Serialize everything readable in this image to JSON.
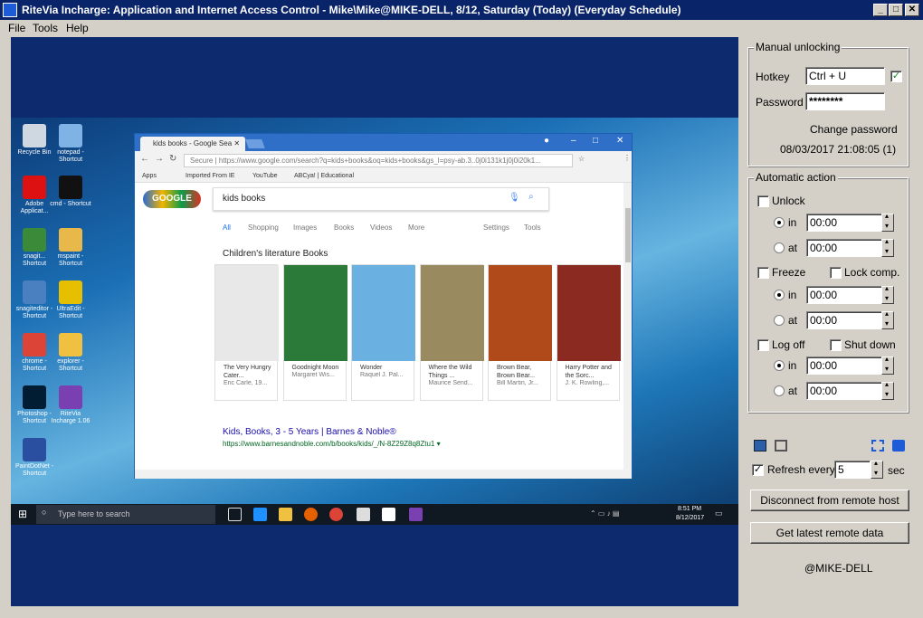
{
  "window": {
    "title": "RiteVia Incharge: Application and Internet Access Control - Mike\\Mike@MIKE-DELL, 8/12, Saturday (Today) (Everyday Schedule)",
    "minimize": "_",
    "maximize": "□",
    "close": "✕"
  },
  "menu": [
    "File",
    "Tools",
    "Help"
  ],
  "remote_desktop": {
    "desktop_icons": [
      {
        "label": "Recycle Bin",
        "color": "#cfd8e0"
      },
      {
        "label": "notepad - Shortcut",
        "color": "#7fb3e6"
      },
      {
        "label": "Adobe Applicat...",
        "color": "#d11"
      },
      {
        "label": "cmd - Shortcut",
        "color": "#111"
      },
      {
        "label": "snagit... Shortcut",
        "color": "#3a8a3a"
      },
      {
        "label": "mspaint - Shortcut",
        "color": "#e8b84a"
      },
      {
        "label": "snagiteditor - Shortcut",
        "color": "#4a7fc0"
      },
      {
        "label": "UltraEdit - Shortcut",
        "color": "#e6c000"
      },
      {
        "label": "chrome - Shortcut",
        "color": "#db4437"
      },
      {
        "label": "explorer - Shortcut",
        "color": "#f0c040"
      },
      {
        "label": "Photoshop - Shortcut",
        "color": "#001d34"
      },
      {
        "label": "RiteVia Incharge 1.06",
        "color": "#7a3fb0"
      },
      {
        "label": "PaintDotNet - Shortcut",
        "color": "#2a4fa0"
      }
    ],
    "browser": {
      "tab_title": "kids books - Google Sea",
      "url": "Secure | https://www.google.com/search?q=kids+books&oq=kids+books&gs_l=psy-ab.3..0j0i131k1j0j0i20k1...",
      "bookmarks": [
        "Apps",
        "Imported From IE",
        "YouTube",
        "ABCya! | Educational"
      ],
      "logo_text": "GOOGLE",
      "search_query": "kids books",
      "nav": [
        "All",
        "Shopping",
        "Images",
        "Books",
        "Videos",
        "More",
        "Settings",
        "Tools"
      ],
      "section_title": "Children's literature Books",
      "books": [
        {
          "title": "The Very Hungry Cater...",
          "author": "Eric Carle, 19...",
          "color": "#e8e8e8"
        },
        {
          "title": "Goodnight Moon",
          "author": "Margaret Wis...",
          "color": "#2c7a3a"
        },
        {
          "title": "Wonder",
          "author": "Raquel J. Pal...",
          "color": "#6ab0e0"
        },
        {
          "title": "Where the Wild Things ...",
          "author": "Maurice Send...",
          "color": "#9a8a60"
        },
        {
          "title": "Brown Bear, Brown Bear...",
          "author": "Bill Martin, Jr...",
          "color": "#b04a1a"
        },
        {
          "title": "Harry Potter and the Sorc...",
          "author": "J. K. Rowling,...",
          "color": "#8a2a20"
        }
      ],
      "result_title": "Kids, Books, 3 - 5 Years | Barnes & Noble®",
      "result_url": "https://www.barnesandnoble.com/b/books/kids/_/N-8Z29Z8q8Ztu1 ▾"
    },
    "taskbar": {
      "search_placeholder": "Type here to search",
      "time": "8:51 PM",
      "date": "8/12/2017"
    }
  },
  "manual_unlocking": {
    "legend": "Manual unlocking",
    "hotkey_label": "Hotkey",
    "hotkey_value": "Ctrl + U",
    "hotkey_checked": "✓",
    "password_label": "Password",
    "password_value": "********",
    "change_password": "Change password",
    "timestamp": "08/03/2017 21:08:05 (1)"
  },
  "automatic_action": {
    "legend": "Automatic action",
    "unlock_label": "Unlock",
    "in_label": "in",
    "at_label": "at",
    "unlock_in": "00:00",
    "unlock_at": "00:00",
    "freeze_label": "Freeze",
    "lock_label": "Lock comp.",
    "freeze_in": "00:00",
    "freeze_at": "00:00",
    "logoff_label": "Log off",
    "shutdown_label": "Shut down",
    "logoff_in": "00:00",
    "logoff_at": "00:00"
  },
  "remote": {
    "refresh_checked": "✓",
    "refresh_label": "Refresh every",
    "refresh_value": "5",
    "refresh_unit": "sec",
    "disconnect_button": "Disconnect from remote host",
    "latest_button": "Get latest remote data",
    "host": "@MIKE-DELL"
  }
}
